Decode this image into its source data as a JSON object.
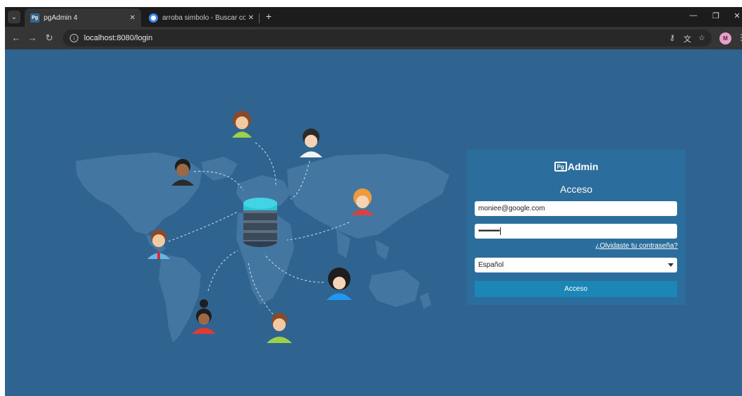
{
  "browser": {
    "tabs": [
      {
        "title": "pgAdmin 4",
        "favicon": "Pg",
        "active": true
      },
      {
        "title": "arroba simbolo - Buscar con Google",
        "favicon": "google-icon",
        "active": false
      }
    ],
    "url": "localhost:8080/login",
    "profile_initial": "M"
  },
  "login": {
    "logo_pg": "Pg",
    "logo_text": "Admin",
    "title": "Acceso",
    "email_value": "moniee@google.com",
    "password_value": "••••••••••••",
    "forgot_link": "¿Olvidaste tu contraseña?",
    "language_value": "Español",
    "submit_label": "Acceso"
  },
  "colors": {
    "page_bg": "#306490",
    "card_bg": "#2b6e9e",
    "button_bg": "#1c87b7"
  }
}
